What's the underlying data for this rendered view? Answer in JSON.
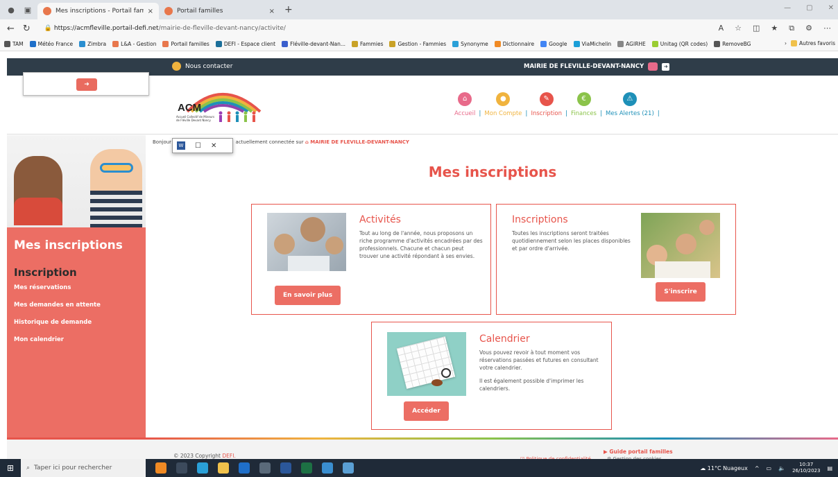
{
  "browser": {
    "tabs": [
      {
        "title": "Mes inscriptions - Portail familles",
        "close": "×"
      },
      {
        "title": "Portail familles",
        "close": "×"
      }
    ],
    "new_tab": "+",
    "url_host": "https://acmfleville.portail-defi.net",
    "url_path": "/mairie-de-fleville-devant-nancy/activite/",
    "bookmarks": [
      "TAM",
      "Météo France",
      "Zimbra",
      "L&A - Gestion",
      "Portail familles",
      "DEFI - Espace client",
      "Fléville-devant-Nan...",
      "Fammies",
      "Gestion - Fammies",
      "Synonyme",
      "Dictionnaire",
      "Google",
      "ViaMichelin",
      "AGIRHE",
      "Unitag (QR codes)",
      "RemoveBG"
    ],
    "bookmarks_other": "Autres favoris"
  },
  "topbar": {
    "contact": "Nous contacter",
    "mairie": "MAIRIE DE FLEVILLE-DEVANT-NANCY"
  },
  "logo": {
    "acm": "ACM",
    "sub": "Accueil Collectif de Mineurs de Fléville Devant Nancy"
  },
  "nav": [
    {
      "label": "Accueil",
      "color": "#e86a8a"
    },
    {
      "label": "Mon Compte",
      "color": "#f0b33e"
    },
    {
      "label": "Inscription",
      "color": "#e7544b"
    },
    {
      "label": "Finances",
      "color": "#8bc34a"
    },
    {
      "label": "Mes Alertes (21)",
      "color": "#1e90b8"
    }
  ],
  "sidebar": {
    "title": "Mes inscriptions",
    "section": "Inscription",
    "links": [
      "Mes réservations",
      "Mes demandes en attente",
      "Historique de demande",
      "Mon calendrier"
    ]
  },
  "greeting": {
    "prefix": "Bonjour",
    "suffix": "actuellement connectée sur",
    "mairie": "MAIRIE DE FLEVILLE-DEVANT-NANCY"
  },
  "page_title": "Mes inscriptions",
  "cards": {
    "activites": {
      "title": "Activités",
      "text": "Tout au long de l'année, nous proposons un riche programme d'activités encadrées par des professionnels. Chacune et chacun peut trouver une activité répondant à ses envies.",
      "button": "En savoir plus"
    },
    "inscriptions": {
      "title": "Inscriptions",
      "text": "Toutes les inscriptions seront traitées quotidiennement selon les places disponibles et par ordre d'arrivée.",
      "button": "S'inscrire"
    },
    "calendrier": {
      "title": "Calendrier",
      "text1": "Vous pouvez revoir à tout moment vos réservations passées et futures en consultant votre calendrier.",
      "text2": "Il est également possible d'imprimer les calendriers.",
      "button": "Accéder"
    }
  },
  "footer": {
    "copyright": "© 2023 Copyright",
    "brand": "DEFI.",
    "guide": "▶ Guide portail familles",
    "privacy": "Politique de confidentialité",
    "cookies": "Gestion des cookies"
  },
  "taskbar": {
    "search": "Taper ici pour rechercher",
    "weather": "11°C Nuageux",
    "time": "10:37",
    "date": "26/10/2023"
  }
}
